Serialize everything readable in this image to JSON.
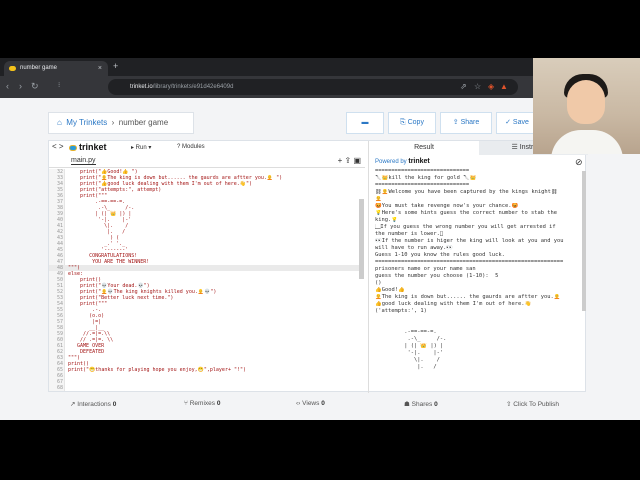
{
  "browser": {
    "tab_title": "number game",
    "tab_close": "×",
    "new_tab": "+",
    "url_host": "trinket.io",
    "url_path": "/library/trinkets/e91d42e6409d"
  },
  "breadcrumb": {
    "home_icon": "home-icon",
    "link": "My Trinkets",
    "separator": "›",
    "current": "number game"
  },
  "actions": {
    "folder_icon": "folder-icon",
    "copy": "Copy",
    "share": "Share",
    "save": "Save"
  },
  "editor": {
    "logo": "trinket",
    "run_label": "▸ Run",
    "modules_label": "? Modules",
    "filename": "main.py",
    "lines": [
      {
        "n": "32",
        "c": "    print(\"👍Good!👍 \")"
      },
      {
        "n": "33",
        "c": "    print(\"🧑‍🦲The king is down but...... the gaurds are aftter you.🧑‍🦲 \")"
      },
      {
        "n": "34",
        "c": "    print(\"👍good luck dealing with them I'm out of here.👋\")"
      },
      {
        "n": "35",
        "c": "    print(\"attempts:\", attempt)"
      },
      {
        "n": "36",
        "c": "    print(\"\"\""
      },
      {
        "n": "37",
        "c": "         .-==-==-=."
      },
      {
        "n": "38",
        "c": "          .-\\_     /-."
      },
      {
        "n": "39",
        "c": "         | (| 👑 |) |"
      },
      {
        "n": "40",
        "c": "          '-|.    |-'"
      },
      {
        "n": "41",
        "c": "            \\|.    /"
      },
      {
        "n": "42",
        "c": "             |.   /"
      },
      {
        "n": "43",
        "c": "              ) ("
      },
      {
        "n": "44",
        "c": "            _.' '._"
      },
      {
        "n": "45",
        "c": "           '-------'"
      },
      {
        "n": "46",
        "c": "       CONGRATULATIONS!"
      },
      {
        "n": "47",
        "c": "        YOU ARE THE WINNER!"
      },
      {
        "n": "48",
        "c": "\"\"\")"
      },
      {
        "n": "49",
        "c": "else:"
      },
      {
        "n": "50",
        "c": "    print()"
      },
      {
        "n": "51",
        "c": "    print(\"💀Your dead.💀\")"
      },
      {
        "n": "52",
        "c": "    print(\"🧑‍🦲💀The king knights killed you.🧑‍🦲💀\")"
      },
      {
        "n": "53",
        "c": "    print(\"Better luck next time.\")"
      },
      {
        "n": "54",
        "c": "    print(\"\"\""
      },
      {
        "n": "55",
        "c": "        .-."
      },
      {
        "n": "56",
        "c": "       (o.o)"
      },
      {
        "n": "57",
        "c": "        |=|"
      },
      {
        "n": "58",
        "c": "       __|__"
      },
      {
        "n": "59",
        "c": "     //.=|=.\\\\"
      },
      {
        "n": "60",
        "c": "    // .=|=. \\\\"
      },
      {
        "n": "61",
        "c": "   GAME OVER"
      },
      {
        "n": "62",
        "c": "    DEFEATED"
      },
      {
        "n": "63",
        "c": "\"\"\")"
      },
      {
        "n": "64",
        "c": "print()"
      },
      {
        "n": "65",
        "c": "print(\"😁thanks for playing hope you enjoy,😁\",player+ \"!\")"
      },
      {
        "n": "66",
        "c": ""
      },
      {
        "n": "67",
        "c": ""
      },
      {
        "n": "68",
        "c": ""
      }
    ]
  },
  "result": {
    "tab_result": "Result",
    "tab_instructions": "Instructions",
    "powered_by": "Powered by",
    "powered_logo": "trinket",
    "output": [
      "=============================",
      "🔪👑kill the king for gold 🔪👑",
      "=============================",
      "⛓🧑‍🦲Welcome you have been captured by the kings knight⛓",
      "🧑‍🦲",
      "😡You must take revenge now's your chance.😡",
      "💡Here's some hints guess the correct number to stab the",
      "king.💡",
      "🏻If you guess the wrong number you will get arrested if",
      "the number is lower.🏻",
      "👀If the number is higer the king will look at you and you",
      "will have to run away.👀",
      "Guess 1-10 you know the rules good luck.",
      "==========================================================",
      "prisoners name or your name san",
      "guess the number you choose (1-10):  5",
      "()",
      "👍Good!👍",
      "🧑‍🦲The king is down but...... the gaurds are aftter you.🧑‍🦲",
      "👍good luck dealing with them I'm out of here.👋",
      "('attempts:', 1)",
      "",
      "",
      "         .-==-==-=.",
      "          .-\\_     /-.",
      "         | (| 👑 |) |",
      "          '-|.    |-'",
      "            \\|.    /",
      "             |.   /"
    ]
  },
  "stats": {
    "interactions": "Interactions",
    "interactions_count": "0",
    "remixes": "Remixes",
    "remixes_count": "0",
    "views": "Views",
    "views_count": "0",
    "shares": "Shares",
    "shares_count": "0",
    "publish": "Click To Publish"
  }
}
